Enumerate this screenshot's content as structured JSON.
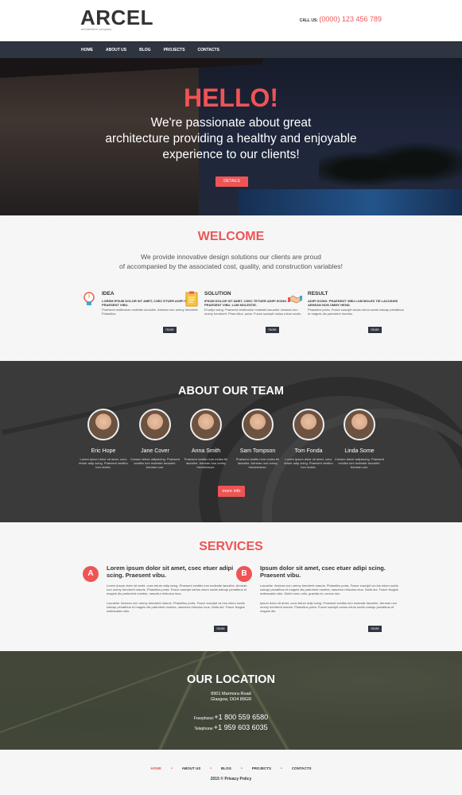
{
  "header": {
    "logo": "ARCEL",
    "logo_sub": "architecture company",
    "call_label": "CALL US:",
    "phone": "(0000) 123 456 789"
  },
  "nav": {
    "items": [
      {
        "label": "HOME"
      },
      {
        "label": "ABOUT US"
      },
      {
        "label": "BLOG"
      },
      {
        "label": "PROJECTS"
      },
      {
        "label": "CONTACTS"
      }
    ]
  },
  "hero": {
    "title": "HELLO!",
    "line1": "We're passionate about great",
    "line2": "architecture providing a healthy and enjoyable",
    "line3": "experience to our clients!",
    "button": "DETAILS"
  },
  "welcome": {
    "title": "WELCOME",
    "lead1": "We provide innovative design solutions our clients are proud",
    "lead2": "of accompanied by the associated cost, quality, and construction variables!",
    "features": [
      {
        "icon": "lightbulb-icon",
        "title": "IDEA",
        "caps": "LOREM IPSUM DOLOR SIT AMET, CSEC ETUER ADIPI SCING. PRAESENT VIBU.",
        "text": "Praesent vestibulum molestie lacusihe. Aenean non ummy hendrerit. Phasellus.",
        "more": "more"
      },
      {
        "icon": "clipboard-icon",
        "title": "SOLUTION",
        "caps": "IPSUM DOLOR SIT AMET, CSEC TETUER ADIPI SCING. PRAESENT VIBU. LUM MOLESTIE.",
        "text": "Et adipi scing. Praesent vestibulum molestie lacusihe. Aenean non ummy hendrerit. Phas ellus. porta. Fusce suscipit varius mium sociis.",
        "more": "more"
      },
      {
        "icon": "handshake-icon",
        "title": "RESULT",
        "caps": "ADIPI SCING. PRAESENT VIBU LUM MOLES TIE LACUSIHS AENEAN NON UMMY HEND.",
        "text": "Phasellus porta. Fusce suscipit varius mium sociis natoqu penatibus et magnis dis parturient montes.",
        "more": "more"
      }
    ]
  },
  "team": {
    "title": "ABOUT OUR TEAM",
    "members": [
      {
        "name": "Eric Hope",
        "desc": "Lorem ipsum dolor sit amet, conc tetuer adip scing. Praesent vestibu lum moles."
      },
      {
        "name": "Jane Cover",
        "desc": "Consec tetuer adipiscing. Praesent vestibu lum molestie lacusihe. Aenean non."
      },
      {
        "name": "Anna Smith",
        "desc": "Praesent vestibu lum moles tie lacusihe. Aenean non ummy hendrerauro."
      },
      {
        "name": "Sam Tompson",
        "desc": "Praesent vestibu lum moles tie lacusihe. Aenean non ummy hendrerauro."
      },
      {
        "name": "Tom Fonda",
        "desc": "Lorem ipsum dolor sit amet, conc tetuer adip scing. Praesent vestibu lum moles."
      },
      {
        "name": "Linda Some",
        "desc": "Consec tetuer adipiscing. Praesent vestibu lum molestie lacusihe. Aenean non."
      }
    ],
    "button": "more info"
  },
  "services": {
    "title": "SERVICES",
    "items": [
      {
        "badge": "A",
        "title": "Lorem ipsum dolor sit amet, csec etuer adipi scing. Praesent vibu.",
        "text1": "Lorem ipsum dolor sit amet, conc tetuer adip scing. Praesent vestibu lum molestie lacusihe. Aenean non ummy hendrerit mauris. Phasellus porta. Fusce suscipit varius mium sociis natoqu penatibus et magnis dis parturient montes, nascetur ridiculus mus.",
        "text2": "Lacusihe. Aenean non ummy hendrerit mauris. Phasellus porta. Fusce suscipit va rius mium sociis natoqu penatibus et magnis dis parturient montes, nascetur ridiculus mus. Nulla dui. Fusce feugiat malesuada odio.",
        "more": "more"
      },
      {
        "badge": "B",
        "title": "Ipsum dolor sit amet, csec etuer adipi scing. Praesent vibu.",
        "text1": "Lacusihe. Aenean non ummy hendrerit mauris. Phasellus porta. Fusce suscipit va rius mium sociis natoqu penatibus et magnis dis parturient montes, nascetur ridiculus mus. Nulla dui. Fusce feugiat malesuada odio. Morbi nunc odio, gravida at, cursus nec.",
        "text2": "Ipsum dolor sit amet, conc tetuer adip scing. Praesent vestibu lum molestie lacusihe. Aenean non ummy hendrerit mauris. Phasellus porta. Fusce suscipit varius mium sociis natoqu penatibus et magnis dis.",
        "more": "more"
      }
    ]
  },
  "location": {
    "title": "OUR LOCATION",
    "addr1": "8901 Marmora Road",
    "addr2": "Glasgow, DO4 89GR",
    "freephone_label": "Freephone:",
    "freephone": "+1 800 559 6580",
    "telephone_label": "Telephone:",
    "telephone": "+1 959 603 6035"
  },
  "footer": {
    "items": [
      {
        "label": "HOME"
      },
      {
        "label": "ABOUT US"
      },
      {
        "label": "BLOG"
      },
      {
        "label": "PROJECTS"
      },
      {
        "label": "CONTACTS"
      }
    ],
    "copy": "2015 © Privacy Policy"
  }
}
